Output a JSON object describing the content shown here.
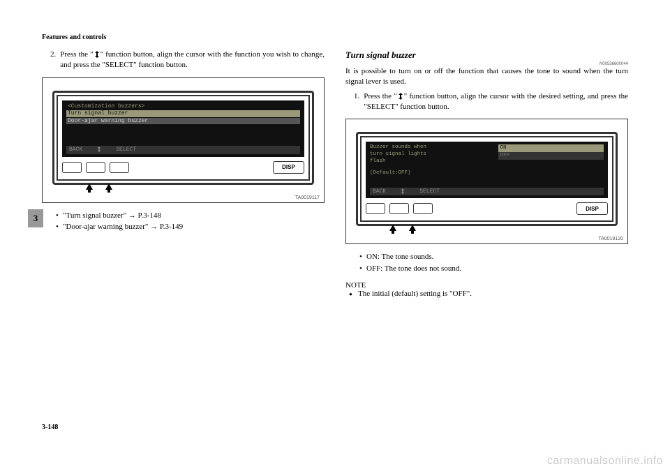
{
  "header": "Features and controls",
  "sidetab": "3",
  "page_number": "3-148",
  "watermark": "carmanualsonline.info",
  "left_col": {
    "step_num": "2.",
    "step_text_a": "Press the \"",
    "step_text_b": "\" function button, align the cursor with the function you wish to change, and press the \"SELECT\" function button.",
    "figure": {
      "screen_title": "<Customization buzzers>",
      "row1": "Turn signal buzzer",
      "row2": "Door-ajar warning buzzer",
      "footer_back": "BACK",
      "footer_select": "SELECT",
      "disp": "DISP",
      "code": "TA0019117"
    },
    "bullets": [
      "\"Turn signal buzzer\" → P.3-148",
      "\"Door-ajar warning buzzer\" → P.3-149"
    ]
  },
  "right_col": {
    "subheading": "Turn signal buzzer",
    "docnum": "N00536600044",
    "intro": "It is possible to turn on or off the function that causes the tone to sound when the turn signal lever is used.",
    "step_num": "1.",
    "step_text_a": "Press the \"",
    "step_text_b": "\" function button, align the cursor with the desired setting, and press the \"SELECT\" function button.",
    "figure": {
      "left_line1": "Buzzer sounds when",
      "left_line2": "turn signal lights",
      "left_line3": "flash",
      "left_line4": "(Default:OFF)",
      "opt_on": "ON",
      "opt_off": "OFF",
      "footer_back": "BACK",
      "footer_select": "SELECT",
      "disp": "DISP",
      "code": "TA0019120"
    },
    "bullets": [
      "ON: The tone sounds.",
      "OFF: The tone does not sound."
    ],
    "note_label": "NOTE",
    "note_body": "The initial (default) setting is \"OFF\"."
  }
}
